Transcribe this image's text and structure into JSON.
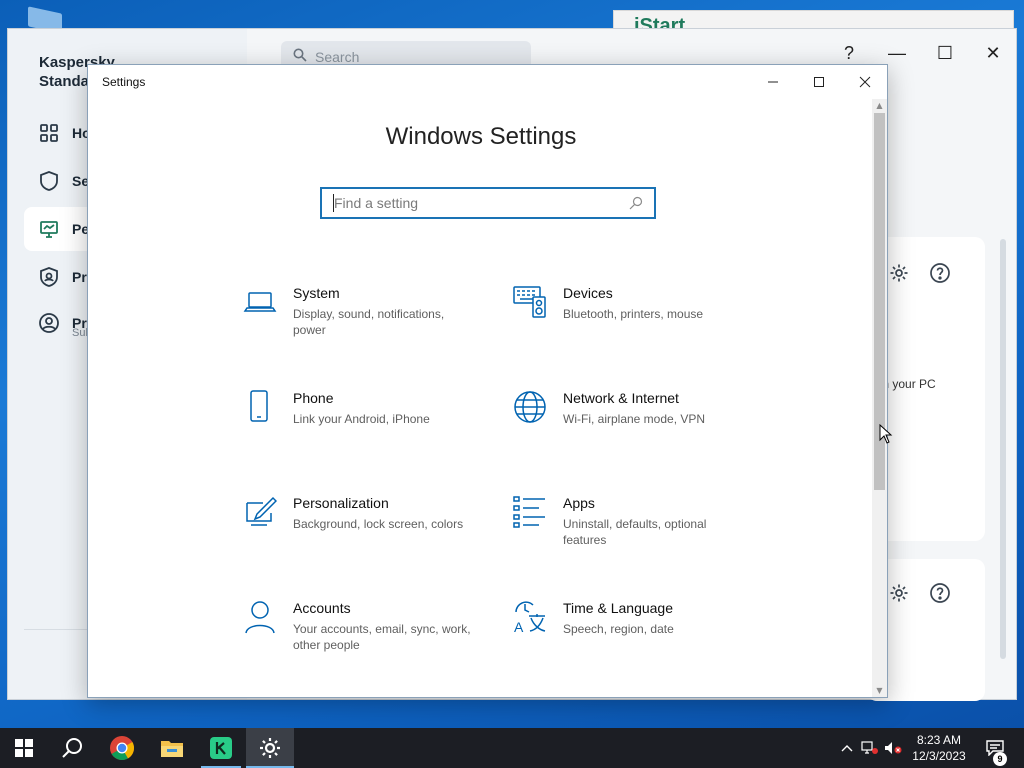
{
  "desktop": {},
  "background_app": {
    "logo_text": "iStart"
  },
  "kaspersky": {
    "brand_line1": "Kaspersky",
    "brand_line2": "Standa",
    "nav": [
      {
        "label": "Ho",
        "icon": "grid-icon"
      },
      {
        "label": "Se",
        "icon": "shield-icon"
      },
      {
        "label": "Pe",
        "icon": "monitor-icon",
        "active": true
      },
      {
        "label": "Pri",
        "icon": "privacy-shield-icon"
      },
      {
        "label": "Pro",
        "icon": "profile-icon"
      }
    ],
    "nav_sub": "Sul",
    "search_placeholder": "Search",
    "controls": {
      "help": "?",
      "minimize": "—",
      "maximize": "☐",
      "close": "✕"
    },
    "card_fragment": "own your PC"
  },
  "settings": {
    "window_title": "Settings",
    "heading": "Windows Settings",
    "search_placeholder": "Find a setting",
    "tiles": [
      {
        "name": "System",
        "desc": "Display, sound, notifications, power",
        "icon": "laptop-icon"
      },
      {
        "name": "Devices",
        "desc": "Bluetooth, printers, mouse",
        "icon": "devices-icon"
      },
      {
        "name": "Phone",
        "desc": "Link your Android, iPhone",
        "icon": "phone-icon"
      },
      {
        "name": "Network & Internet",
        "desc": "Wi-Fi, airplane mode, VPN",
        "icon": "globe-icon"
      },
      {
        "name": "Personalization",
        "desc": "Background, lock screen, colors",
        "icon": "paint-icon"
      },
      {
        "name": "Apps",
        "desc": "Uninstall, defaults, optional features",
        "icon": "apps-list-icon"
      },
      {
        "name": "Accounts",
        "desc": "Your accounts, email, sync, work, other people",
        "icon": "person-icon"
      },
      {
        "name": "Time & Language",
        "desc": "Speech, region, date",
        "icon": "time-language-icon"
      }
    ]
  },
  "taskbar": {
    "time": "8:23 AM",
    "date": "12/3/2023",
    "notification_count": "9",
    "apps": [
      "start-icon",
      "search-icon",
      "chrome-icon",
      "file-explorer-icon",
      "kaspersky-icon",
      "settings-gear-icon"
    ]
  },
  "colors": {
    "accent": "#0063b1",
    "taskbar": "#1c1e24",
    "desktop": "#1a7ad6"
  }
}
